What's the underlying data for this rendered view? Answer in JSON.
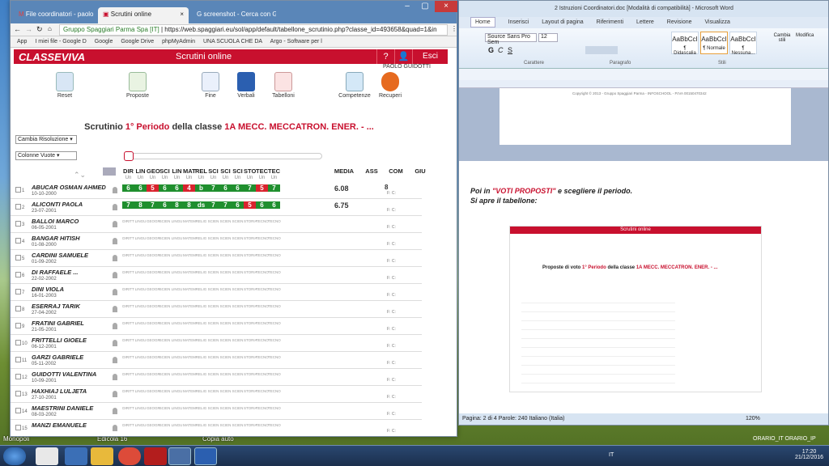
{
  "browser": {
    "tabs": [
      {
        "label": "File coordinatori - paolo"
      },
      {
        "label": "Scrutini online"
      },
      {
        "label": "screenshot - Cerca con G"
      }
    ],
    "url": "https://web.spaggiari.eu/sol/app/default/tabellone_scrutinio.php?classe_id=493658&quad=1&in",
    "site": "Gruppo Spaggiari Parma Spa [IT]",
    "bookmarks": [
      "App",
      "I miei file - Google D",
      "Google",
      "Google Drive",
      "phpMyAdmin",
      "UNA SCUOLA CHE DA",
      "Argo - Software per l"
    ]
  },
  "cv": {
    "logo": "CLASSEVIVA",
    "title": "Scrutini online",
    "help": "?",
    "exit": "Esci",
    "user": "PAOLO GUIDOTTI",
    "tools": [
      {
        "label": "Reset"
      },
      {
        "label": "Proposte"
      },
      {
        "label": "Fine"
      },
      {
        "label": "Verbali"
      },
      {
        "label": "Tabelloni"
      },
      {
        "label": "Competenze"
      },
      {
        "label": "Recuperi"
      }
    ],
    "heading": {
      "prefix": "Scrutinio",
      "period": "1° Periodo",
      "mid": "della classe",
      "cls": "1A MECC. MECCATRON. ENER. - ..."
    },
    "dd1": "Cambia Risoluzione",
    "dd2": "Colonne Vuote",
    "subjects": [
      "DIR",
      "LIN",
      "GEO",
      "SCI",
      "LIN",
      "MAT",
      "REL",
      "SCI",
      "SCI",
      "SCI",
      "STO",
      "TEC",
      "TEC"
    ],
    "un": "Un",
    "extra": [
      "MEDIA",
      "ASS",
      "COM",
      "GIU"
    ],
    "grid_small": [
      "DIRITT",
      "LINGU",
      "GEOGR",
      "SCIEN",
      "LINGU",
      "MATEM",
      "RELIG",
      "SCIEN",
      "SCIEN",
      "SCIEN",
      "STORIA",
      "TECNO",
      "TECNO"
    ],
    "fc": "F: C:",
    "students": [
      {
        "n": "1",
        "name": "ABUCAR OSMAN AHMED",
        "date": "10-10-2000",
        "media": "6.08",
        "com": "8",
        "grades": [
          "6",
          "6",
          "5",
          "6",
          "6",
          "4",
          "b",
          "7",
          "6",
          "6",
          "7",
          "5",
          "7"
        ],
        "colors": [
          "g",
          "g",
          "r",
          "g",
          "g",
          "r",
          "g",
          "g",
          "g",
          "g",
          "g",
          "r",
          "g"
        ]
      },
      {
        "n": "2",
        "name": "ALICONTI PAOLA",
        "date": "23-07-2001",
        "media": "6.75",
        "com": "",
        "grades": [
          "7",
          "8",
          "7",
          "6",
          "8",
          "8",
          "ds",
          "7",
          "7",
          "6",
          "5",
          "6",
          "6"
        ],
        "colors": [
          "g",
          "g",
          "g",
          "g",
          "g",
          "g",
          "g",
          "g",
          "g",
          "g",
          "r",
          "g",
          "g"
        ]
      },
      {
        "n": "3",
        "name": "BALLOI MARCO",
        "date": "06-05-2001"
      },
      {
        "n": "4",
        "name": "BANGAR HITISH",
        "date": "01-08-2000"
      },
      {
        "n": "5",
        "name": "CARDINI SAMUELE",
        "date": "01-09-2002"
      },
      {
        "n": "6",
        "name": "DI RAFFAELE ...",
        "date": "22-02-2002"
      },
      {
        "n": "7",
        "name": "DINI VIOLA",
        "date": "16-01-2003"
      },
      {
        "n": "8",
        "name": "ESERRAJ TARIK",
        "date": "27-04-2002"
      },
      {
        "n": "9",
        "name": "FRATINI GABRIEL",
        "date": "21-05-2001"
      },
      {
        "n": "10",
        "name": "FRITTELLI GIOELE",
        "date": "06-12-2001"
      },
      {
        "n": "11",
        "name": "GARZI GABRIELE",
        "date": "05-11-2002"
      },
      {
        "n": "12",
        "name": "GUIDOTTI VALENTINA",
        "date": "10-09-2001"
      },
      {
        "n": "13",
        "name": "HAXHIAJ LULJETA",
        "date": "27-10-2001"
      },
      {
        "n": "14",
        "name": "MAESTRINI DANIELE",
        "date": "08-03-2002"
      },
      {
        "n": "15",
        "name": "MANZI EMANUELE",
        "date": ""
      }
    ]
  },
  "word": {
    "title": "2 Istruzioni Coordinatori.doc [Modalità di compatibilità] - Microsoft Word",
    "tabs": [
      "Home",
      "Inserisci",
      "Layout di pagina",
      "Riferimenti",
      "Lettere",
      "Revisione",
      "Visualizza"
    ],
    "font": "Source Sans Pro Sem",
    "size": "12",
    "styles": [
      {
        "p": "AaBbCcI",
        "l": "¶ Didascalia"
      },
      {
        "p": "AaBbCcI",
        "l": "¶ Normale"
      },
      {
        "p": "AaBbCcI",
        "l": "¶ Nessuna..."
      }
    ],
    "groups": [
      "Carattere",
      "Paragrafo",
      "Stili"
    ],
    "change_styles": "Cambia stili",
    "modify": "Modifica",
    "copyright": "Copyright © 2013 - Gruppo Spaggiari Parma - INFOSCHOOL - P.IVA 00150470342",
    "line1a": "Poi in ",
    "line1b": "\"VOTI PROPOSTI\"",
    "line1c": " e scegliere  il periodo.",
    "line2": "Si apre il tabellone:",
    "embed_title": "Scrutini online",
    "embed_heading_a": "Proposte di voto",
    "embed_heading_b": "1° Periodo",
    "embed_heading_c": "della classe",
    "embed_heading_d": "1A MECC. MECCATRON. ENER. - ...",
    "status": "Pagina: 2 di 4   Parole: 240   Italiano (Italia)",
    "zoom": "120%"
  },
  "desktop": {
    "icons": [
      "Monopoli",
      "Edicola 16",
      "Copia auto"
    ]
  },
  "taskbar": {
    "time": "17:20",
    "date": "21/12/2016",
    "lang": "IT",
    "tray": "ORARIO_IT   ORARIO_IP"
  }
}
